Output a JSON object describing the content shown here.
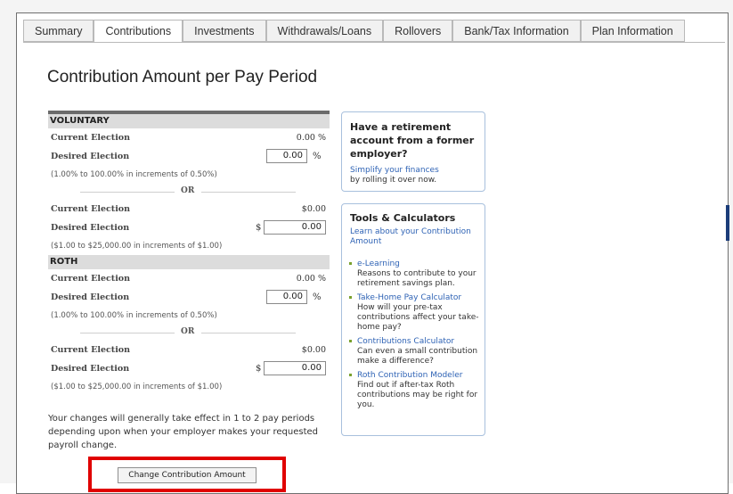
{
  "tabs": [
    "Summary",
    "Contributions",
    "Investments",
    "Withdrawals/Loans",
    "Rollovers",
    "Bank/Tax Information",
    "Plan Information"
  ],
  "page_title": "Contribution Amount per Pay Period",
  "voluntary": {
    "heading": "VOLUNTARY",
    "pct_current_label": "Current Election",
    "pct_current_value": "0.00 %",
    "pct_desired_label": "Desired Election",
    "pct_desired_value": "0.00",
    "pct_unit": "%",
    "pct_note": "(1.00% to 100.00% in increments of 0.50%)",
    "or_label": "OR",
    "amt_current_label": "Current Election",
    "amt_current_value": "$0.00",
    "amt_desired_label": "Desired Election",
    "amt_currency": "$",
    "amt_desired_value": "0.00",
    "amt_note": "($1.00 to $25,000.00 in increments of $1.00)"
  },
  "roth": {
    "heading": "ROTH",
    "pct_current_label": "Current Election",
    "pct_current_value": "0.00 %",
    "pct_desired_label": "Desired Election",
    "pct_desired_value": "0.00",
    "pct_unit": "%",
    "pct_note": "(1.00% to 100.00% in increments of 0.50%)",
    "or_label": "OR",
    "amt_current_label": "Current Election",
    "amt_current_value": "$0.00",
    "amt_desired_label": "Desired Election",
    "amt_currency": "$",
    "amt_desired_value": "0.00",
    "amt_note": "($1.00 to $25,000.00 in increments of $1.00)"
  },
  "disclaimer": "Your changes will generally take effect in 1 to 2 pay periods depending upon when your employer makes your requested payroll change.",
  "change_button": "Change Contribution Amount",
  "retirement_box": {
    "heading": "Have a retirement account from a former employer?",
    "link": "Simplify your finances",
    "text": "by rolling it over now."
  },
  "tools_box": {
    "heading": "Tools & Calculators",
    "intro_link": "Learn about your Contribution Amount",
    "items": [
      {
        "link": "e-Learning",
        "desc": "Reasons to contribute to your retirement savings plan."
      },
      {
        "link": "Take-Home Pay Calculator",
        "desc": "How will your pre-tax contributions affect your take-home pay?"
      },
      {
        "link": "Contributions Calculator",
        "desc": "Can even a small contribution make a difference?"
      },
      {
        "link": "Roth Contribution Modeler",
        "desc": "Find out if after-tax Roth contributions may be right for you."
      }
    ]
  },
  "colors": {
    "accent_link": "#2f63b5",
    "highlight_box": "#e00000",
    "bullet": "#7aa12e"
  }
}
